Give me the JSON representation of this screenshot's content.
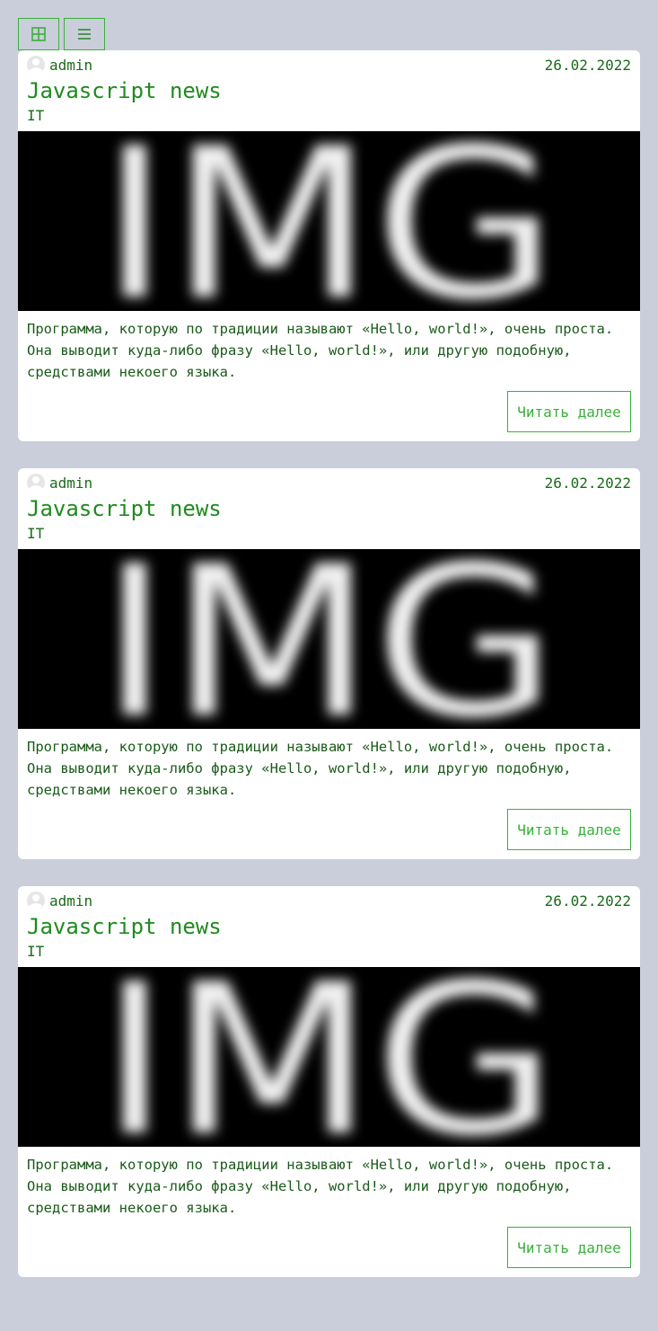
{
  "colors": {
    "background": "#cacdda",
    "accent": "#3ab03a",
    "title": "#1f8a1f",
    "text": "#1a6b1a",
    "card": "#ffffff"
  },
  "toolbar": {
    "grid_view_icon": "grid-view-icon",
    "list_view_icon": "list-view-icon"
  },
  "posts": [
    {
      "author": "admin",
      "date": "26.02.2022",
      "title": "Javascript news",
      "category": "IT",
      "image_text": "IMG",
      "excerpt": "Программа, которую по традиции называют «Hello, world!», очень проста. Она выводит куда-либо фразу «Hello, world!», или другую подобную, средствами некоего языка.",
      "read_more": "Читать далее"
    },
    {
      "author": "admin",
      "date": "26.02.2022",
      "title": "Javascript news",
      "category": "IT",
      "image_text": "IMG",
      "excerpt": "Программа, которую по традиции называют «Hello, world!», очень проста. Она выводит куда-либо фразу «Hello, world!», или другую подобную, средствами некоего языка.",
      "read_more": "Читать далее"
    },
    {
      "author": "admin",
      "date": "26.02.2022",
      "title": "Javascript news",
      "category": "IT",
      "image_text": "IMG",
      "excerpt": "Программа, которую по традиции называют «Hello, world!», очень проста. Она выводит куда-либо фразу «Hello, world!», или другую подобную, средствами некоего языка.",
      "read_more": "Читать далее"
    }
  ]
}
